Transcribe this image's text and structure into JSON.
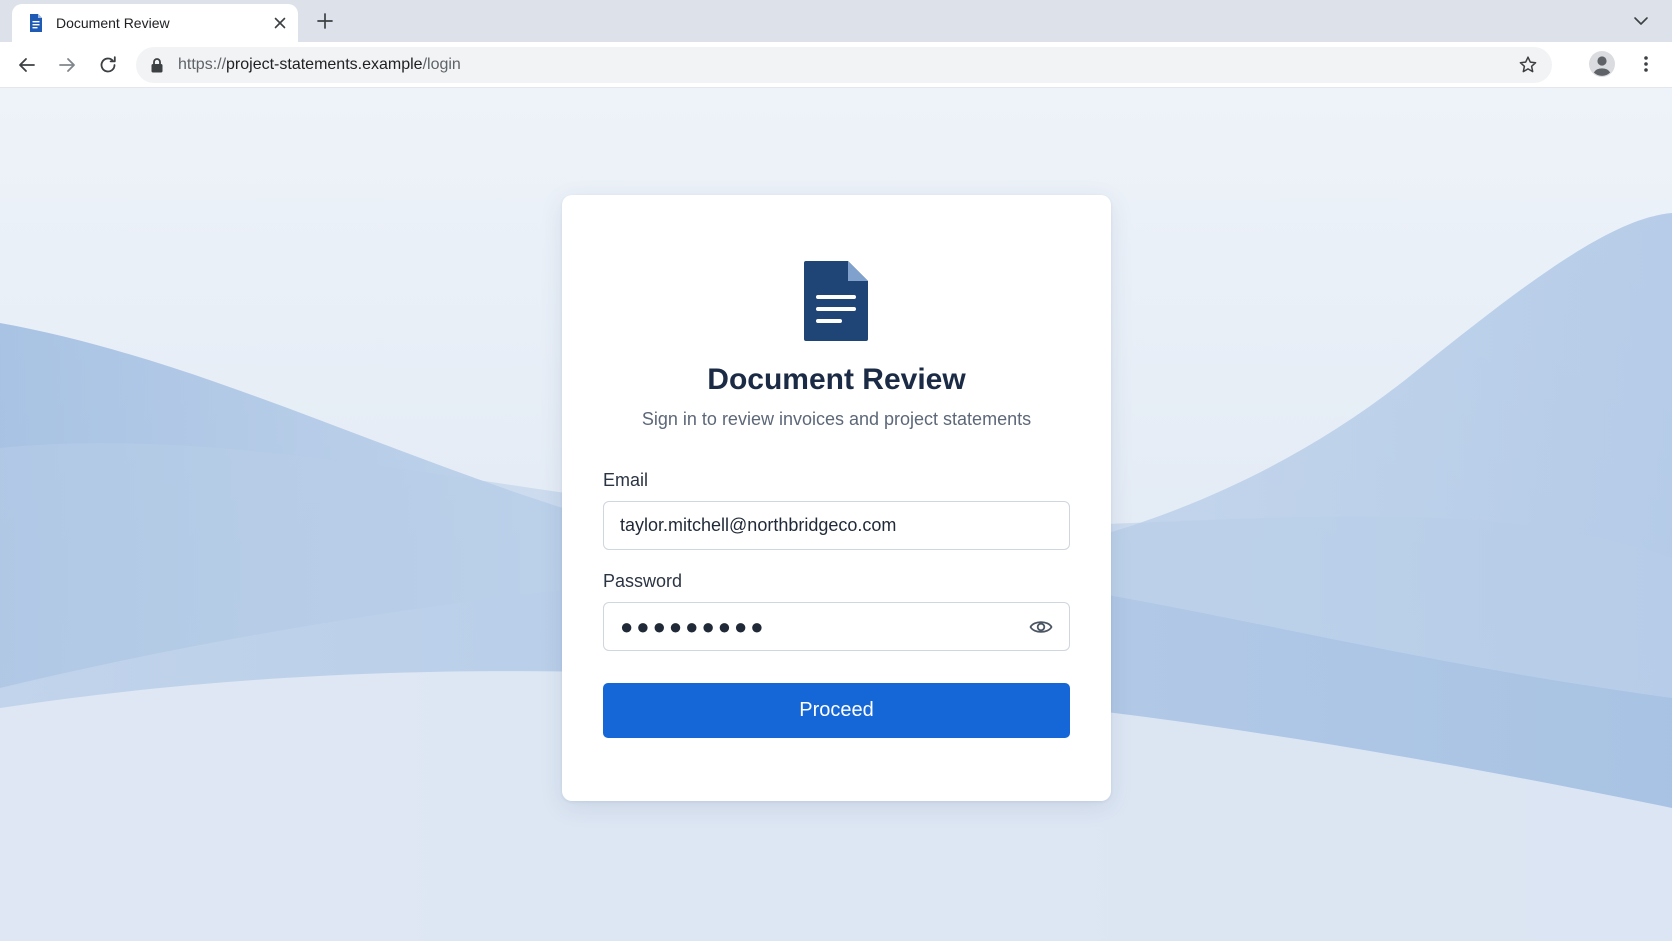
{
  "browser": {
    "tab": {
      "title": "Document Review"
    },
    "address_bar": {
      "scheme": "https://",
      "host": "project-statements.example",
      "path": "/login"
    }
  },
  "login": {
    "title": "Document Review",
    "subtitle": "Sign in to review invoices and project statements",
    "email": {
      "label": "Email",
      "value": "taylor.mitchell@northbridgeco.com"
    },
    "password": {
      "label": "Password",
      "masked_value": "●●●●●●●●●"
    },
    "submit_label": "Proceed"
  },
  "colors": {
    "accent": "#1566d6",
    "logo": "#1f4476",
    "title": "#1b2a45"
  },
  "icons": [
    "document-favicon-icon",
    "close-icon",
    "plus-icon",
    "chevron-down-icon",
    "arrow-left-icon",
    "arrow-right-icon",
    "reload-icon",
    "lock-icon",
    "star-icon",
    "profile-icon",
    "more-vertical-icon",
    "document-icon",
    "eye-icon"
  ]
}
